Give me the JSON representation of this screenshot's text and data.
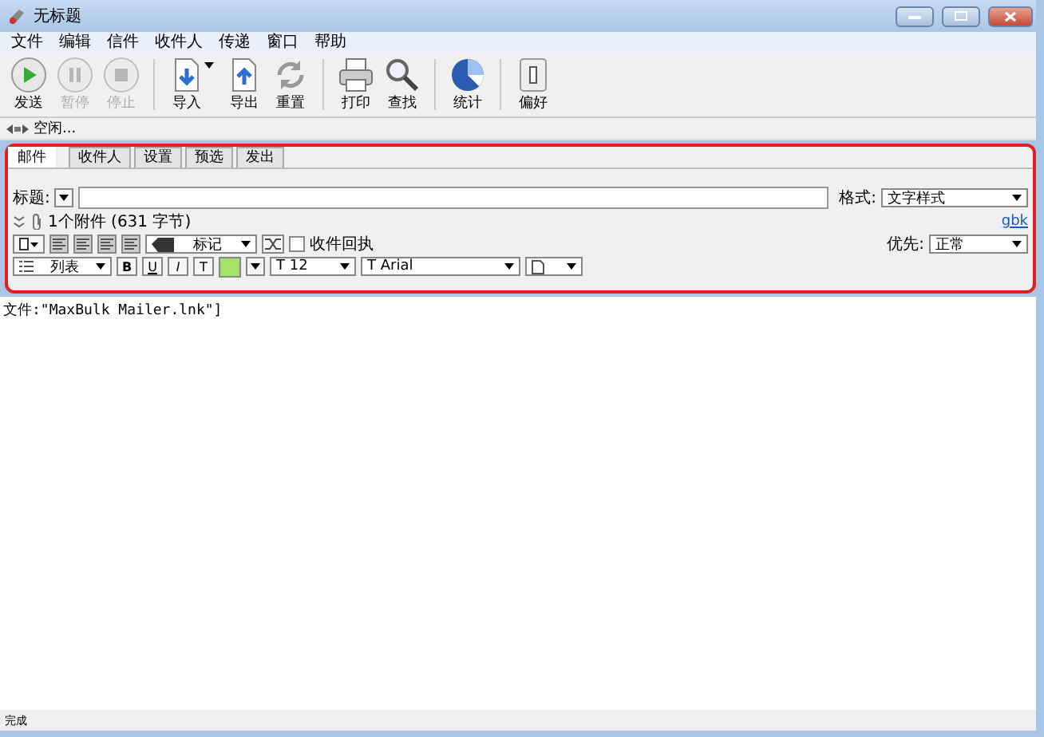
{
  "window": {
    "title": "无标题"
  },
  "menu": [
    "文件",
    "编辑",
    "信件",
    "收件人",
    "传递",
    "窗口",
    "帮助"
  ],
  "toolbar": [
    {
      "label": "发送",
      "kind": "play",
      "disabled": false
    },
    {
      "label": "暂停",
      "kind": "pause",
      "disabled": true
    },
    {
      "label": "停止",
      "kind": "stop",
      "disabled": true
    },
    {
      "label": "导入",
      "kind": "import",
      "disabled": false
    },
    {
      "label": "导出",
      "kind": "export",
      "disabled": false
    },
    {
      "label": "重置",
      "kind": "reset",
      "disabled": false
    },
    {
      "label": "打印",
      "kind": "print",
      "disabled": false
    },
    {
      "label": "查找",
      "kind": "search",
      "disabled": false
    },
    {
      "label": "统计",
      "kind": "pie",
      "disabled": false
    },
    {
      "label": "偏好",
      "kind": "switch",
      "disabled": false
    }
  ],
  "activity": "空闲...",
  "tabs": [
    {
      "label": "邮件",
      "selected": true
    },
    {
      "label": "收件人",
      "selected": false
    },
    {
      "label": "设置",
      "selected": false
    },
    {
      "label": "预选",
      "selected": false
    },
    {
      "label": "发出",
      "selected": false
    }
  ],
  "subject": {
    "label": "标题:"
  },
  "format": {
    "label": "格式:",
    "value": "文字样式"
  },
  "charset_link": "gbk",
  "attachments": "1个附件 (631 字节)",
  "priority": {
    "label": "优先:",
    "value": "正常"
  },
  "mark": {
    "value": "标记"
  },
  "receipt": {
    "label": "收件回执",
    "checked": false
  },
  "list_style": {
    "value": "列表"
  },
  "style_buttons": [
    {
      "kind": "bold",
      "label": "B"
    },
    {
      "kind": "underline",
      "label": "U"
    },
    {
      "kind": "italic",
      "label": "I"
    },
    {
      "kind": "text",
      "label": "T"
    },
    {
      "kind": "color",
      "color": "#a6e36a"
    }
  ],
  "size": {
    "value": "T 12"
  },
  "font": {
    "value": "T Arial"
  },
  "body": "文件:\"MaxBulk Mailer.lnk\"]",
  "status_bar": "完成"
}
